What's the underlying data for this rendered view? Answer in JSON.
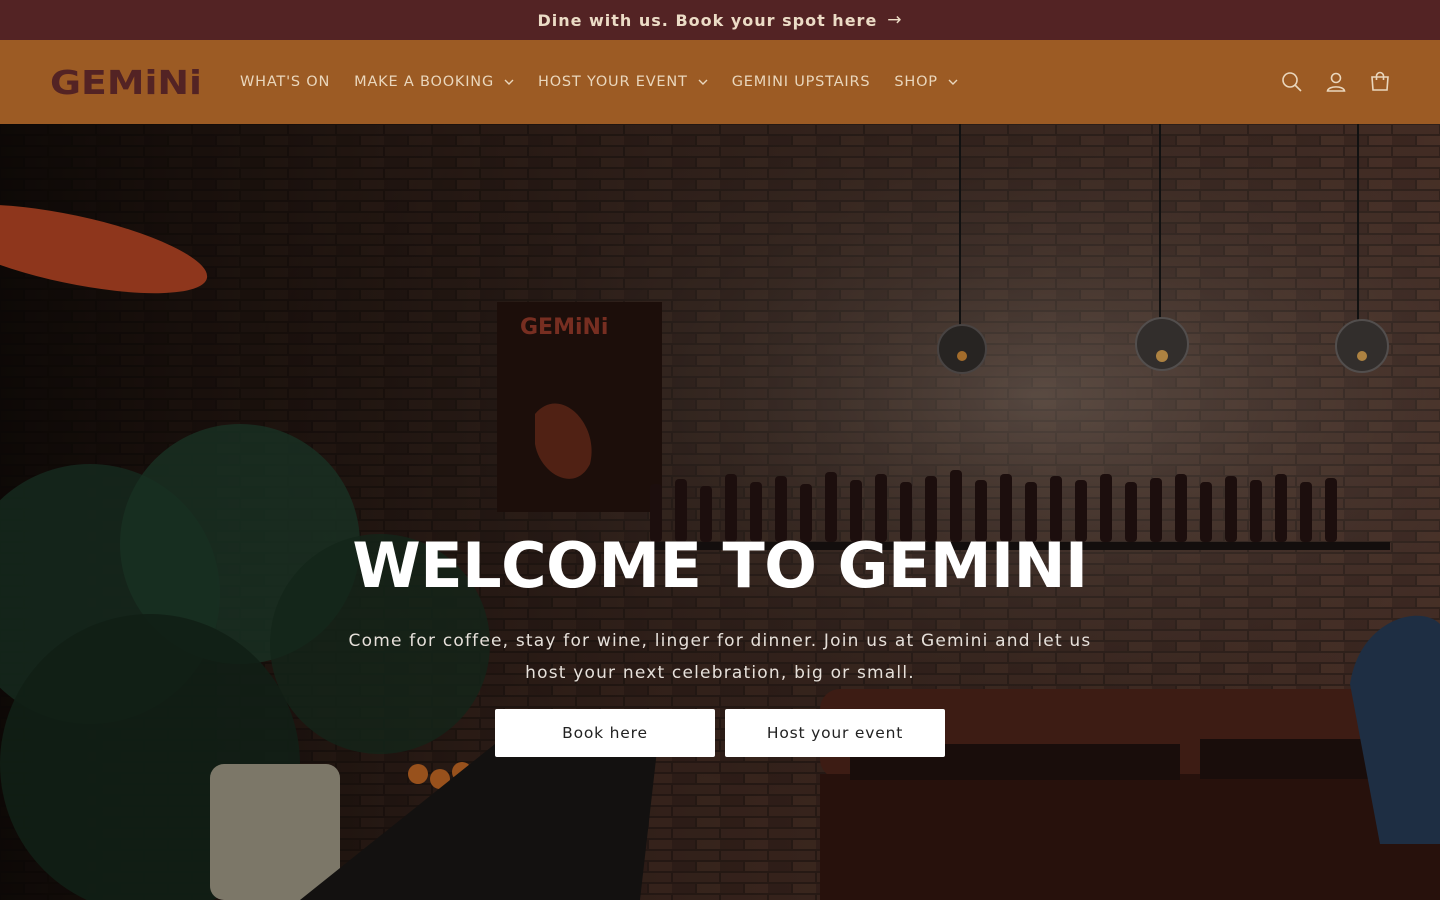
{
  "announcement": {
    "text": "Dine with us. Book your spot here",
    "arrow": "→"
  },
  "header": {
    "logo_text": "GEMiNi",
    "nav": [
      {
        "label": "WHAT'S ON",
        "dropdown": false
      },
      {
        "label": "MAKE A BOOKING",
        "dropdown": true
      },
      {
        "label": "HOST YOUR EVENT",
        "dropdown": true
      },
      {
        "label": "GEMINI UPSTAIRS",
        "dropdown": false
      },
      {
        "label": "SHOP",
        "dropdown": true
      }
    ],
    "icons": [
      "search-icon",
      "account-icon",
      "cart-icon"
    ]
  },
  "hero": {
    "title": "WELCOME TO GEMINI",
    "subtitle": "Come for coffee, stay for wine, linger for dinner. Join us at Gemini and let us host your next celebration, big or small.",
    "buttons": [
      "Book here",
      "Host your event"
    ],
    "poster_text": "GEMiNi"
  },
  "colors": {
    "announcement_bg": "#532324",
    "header_bg": "#9c5b24",
    "logo": "#532324",
    "nav_text": "#ead7bd"
  }
}
